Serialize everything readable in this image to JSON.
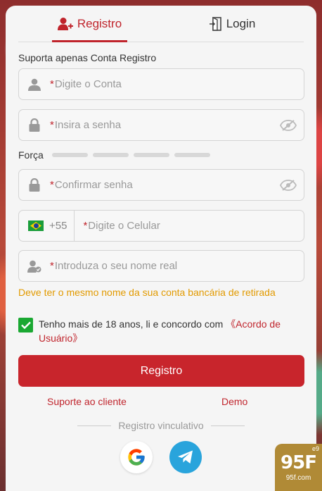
{
  "tabs": [
    {
      "label": "Registro",
      "icon": "add-user-icon",
      "active": true
    },
    {
      "label": "Login",
      "icon": "login-door-icon",
      "active": false
    }
  ],
  "hint": "Suporta apenas Conta Registro",
  "account": {
    "required_mark": "*",
    "placeholder": "Digite o Conta",
    "icon": "user-icon"
  },
  "password": {
    "required_mark": "*",
    "placeholder": "Insira a senha",
    "icon": "lock-icon"
  },
  "strength": {
    "label": "Força",
    "levels": 4
  },
  "confirm": {
    "required_mark": "*",
    "placeholder": "Confirmar senha",
    "icon": "lock-icon"
  },
  "phone": {
    "country_code": "+55",
    "flag": "brazil-flag-icon",
    "required_mark": "*",
    "placeholder": "Digite o Celular"
  },
  "realname": {
    "required_mark": "*",
    "placeholder": "Introduza o seu nome real",
    "icon": "verified-user-icon"
  },
  "warning": "Deve ter o mesmo nome da sua conta bancária de retirada",
  "agreement": {
    "text": "Tenho mais de 18 anos, li e concordo com ",
    "link": "《Acordo de Usuário》",
    "checked": true
  },
  "submit_label": "Registro",
  "support_label": "Suporte ao cliente",
  "demo_label": "Demo",
  "divider_label": "Registro vinculativo",
  "social": [
    "google-icon",
    "telegram-icon"
  ],
  "logo": {
    "big": "95F",
    "small": "95f.com",
    "tag": "e9"
  },
  "colors": {
    "accent": "#c0242c",
    "warning": "#e29a00",
    "check": "#1aa832",
    "telegram": "#29a4dc",
    "logo_bg": "#b08a36"
  }
}
